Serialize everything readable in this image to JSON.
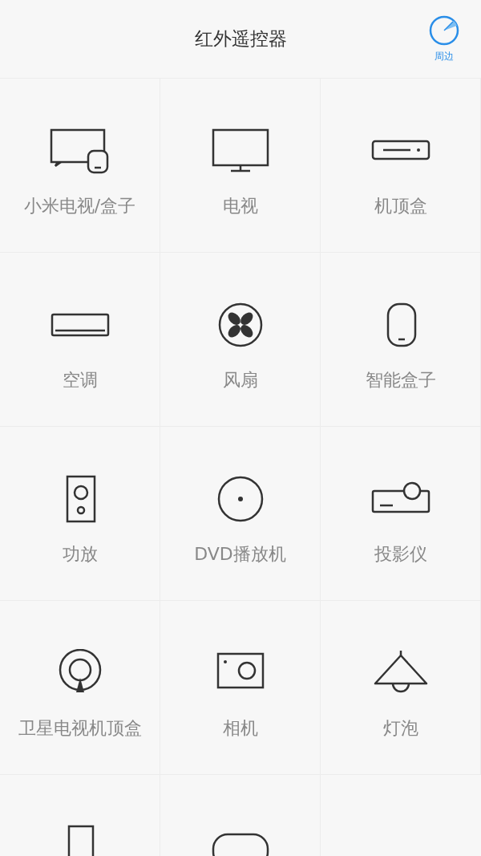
{
  "header": {
    "title": "红外遥控器",
    "nearby_button": {
      "label": "周边"
    }
  },
  "devices": [
    {
      "kind": "mitv",
      "label": "小米电视/盒子"
    },
    {
      "kind": "tv",
      "label": "电视"
    },
    {
      "kind": "stb",
      "label": "机顶盒"
    },
    {
      "kind": "ac",
      "label": "空调"
    },
    {
      "kind": "fan",
      "label": "风扇"
    },
    {
      "kind": "smartbox",
      "label": "智能盒子"
    },
    {
      "kind": "amp",
      "label": "功放"
    },
    {
      "kind": "dvd",
      "label": "DVD播放机"
    },
    {
      "kind": "projector",
      "label": "投影仪"
    },
    {
      "kind": "satellite",
      "label": "卫星电视机顶盒"
    },
    {
      "kind": "camera",
      "label": "相机"
    },
    {
      "kind": "lamp",
      "label": "灯泡"
    },
    {
      "kind": "tall"
    },
    {
      "kind": "pill"
    }
  ]
}
